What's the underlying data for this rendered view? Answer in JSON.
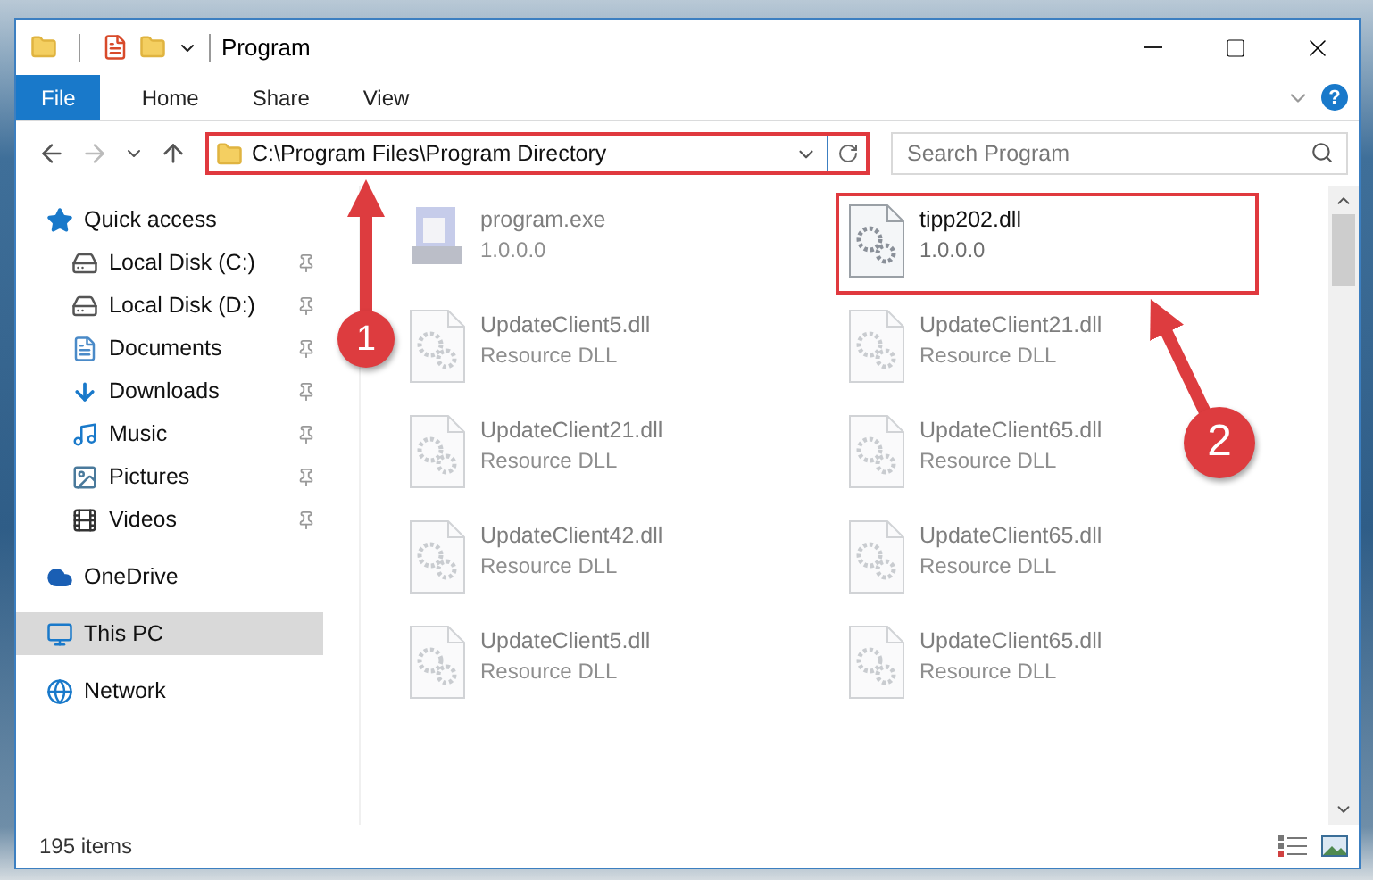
{
  "window": {
    "title": "Program"
  },
  "ribbon": {
    "tabs": [
      {
        "label": "File",
        "kind": "menu"
      },
      {
        "label": "Home",
        "kind": "tab"
      },
      {
        "label": "Share",
        "kind": "tab"
      },
      {
        "label": "View",
        "kind": "tab"
      }
    ],
    "help": "?"
  },
  "address_bar": {
    "path": "C:\\Program Files\\Program Directory",
    "highlighted": true
  },
  "search": {
    "placeholder": "Search Program"
  },
  "sidebar": {
    "items": [
      {
        "label": "Quick access",
        "selected": false,
        "children": [
          {
            "label": "Local Disk (C:)",
            "selected": false,
            "pinned": true
          },
          {
            "label": "Local Disk (D:)",
            "selected": false,
            "pinned": true
          },
          {
            "label": "Documents",
            "selected": false,
            "pinned": true
          },
          {
            "label": "Downloads",
            "selected": false,
            "pinned": true
          },
          {
            "label": "Music",
            "selected": false,
            "pinned": true
          },
          {
            "label": "Pictures",
            "selected": false,
            "pinned": true
          },
          {
            "label": "Videos",
            "selected": false,
            "pinned": true
          }
        ]
      },
      {
        "label": "OneDrive",
        "selected": false
      },
      {
        "label": "This PC",
        "selected": true
      },
      {
        "label": "Network",
        "selected": false
      }
    ]
  },
  "files": [
    {
      "name": "program.exe",
      "detail": "1.0.0.0",
      "kind": "exe",
      "blurred": true,
      "highlighted": false
    },
    {
      "name": "tipp202.dll",
      "detail": "1.0.0.0",
      "kind": "dll",
      "blurred": false,
      "highlighted": true
    },
    {
      "name": "UpdateClient5.dll",
      "detail": "Resource DLL",
      "kind": "dll",
      "blurred": true,
      "highlighted": false
    },
    {
      "name": "UpdateClient21.dll",
      "detail": "Resource DLL",
      "kind": "dll",
      "blurred": true,
      "highlighted": false
    },
    {
      "name": "UpdateClient21.dll",
      "detail": "Resource DLL",
      "kind": "dll",
      "blurred": true,
      "highlighted": false
    },
    {
      "name": "UpdateClient65.dll",
      "detail": "Resource DLL",
      "kind": "dll",
      "blurred": true,
      "highlighted": false
    },
    {
      "name": "UpdateClient42.dll",
      "detail": "Resource DLL",
      "kind": "dll",
      "blurred": true,
      "highlighted": false
    },
    {
      "name": "UpdateClient65.dll",
      "detail": "Resource DLL",
      "kind": "dll",
      "blurred": true,
      "highlighted": false
    },
    {
      "name": "UpdateClient5.dll",
      "detail": "Resource DLL",
      "kind": "dll",
      "blurred": true,
      "highlighted": false
    },
    {
      "name": "UpdateClient65.dll",
      "detail": "Resource DLL",
      "kind": "dll",
      "blurred": true,
      "highlighted": false
    }
  ],
  "callouts": [
    {
      "number": "1"
    },
    {
      "number": "2"
    }
  ],
  "status_bar": {
    "item_count": "195 items"
  }
}
